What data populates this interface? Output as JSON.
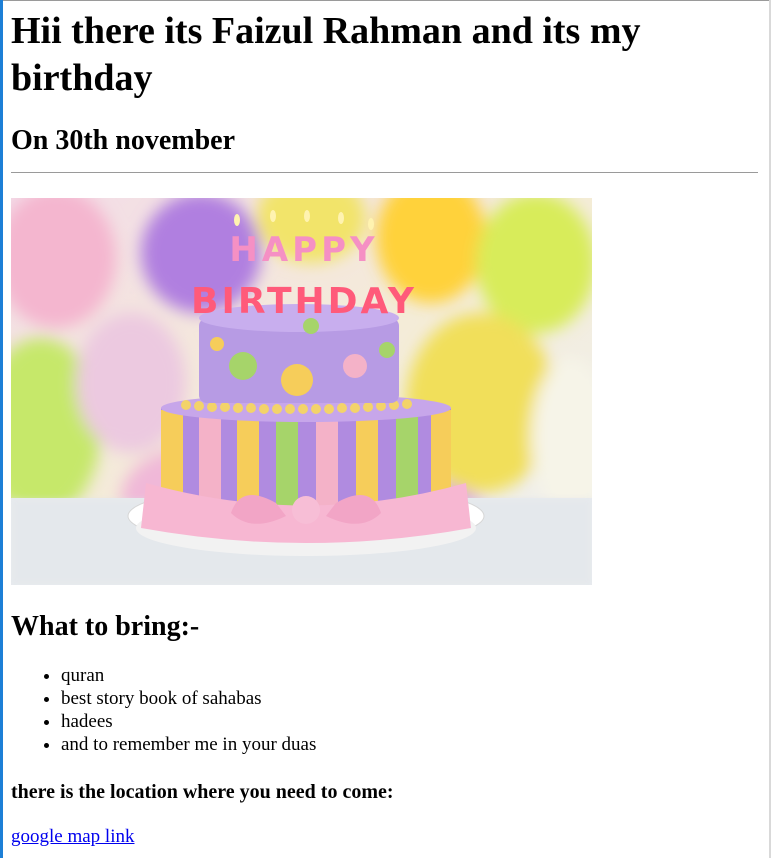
{
  "heading": "Hii there its Faizul Rahman and its my birthday",
  "date": "On 30th november",
  "image": {
    "cake_candles_line1": "HAPPY",
    "cake_candles_line2": "BIRTHDAY"
  },
  "bring_heading": "What to bring:-",
  "bring_items": [
    "quran",
    "best story book of sahabas",
    "hadees",
    "and to remember me in your duas"
  ],
  "location_heading": "there is the location where you need to come:",
  "map_link": "google map link"
}
